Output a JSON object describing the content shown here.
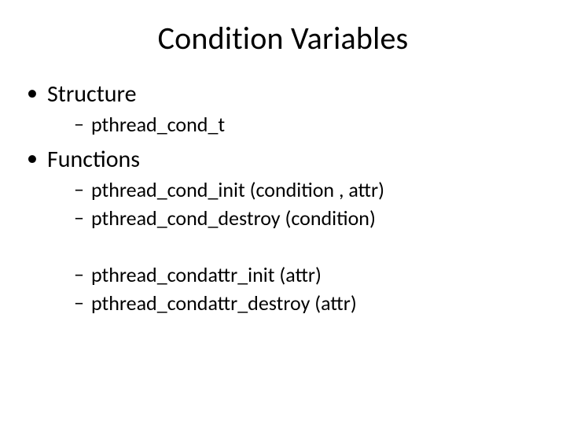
{
  "title": "Condition Variables",
  "bullets": {
    "structure": {
      "label": "Structure",
      "items": [
        "pthread_cond_t"
      ]
    },
    "functions": {
      "label": "Functions",
      "group1": [
        "pthread_cond_init (condition ,  attr)",
        "pthread_cond_destroy (condition)"
      ],
      "group2": [
        "pthread_condattr_init (attr)",
        "pthread_condattr_destroy (attr)"
      ]
    }
  }
}
